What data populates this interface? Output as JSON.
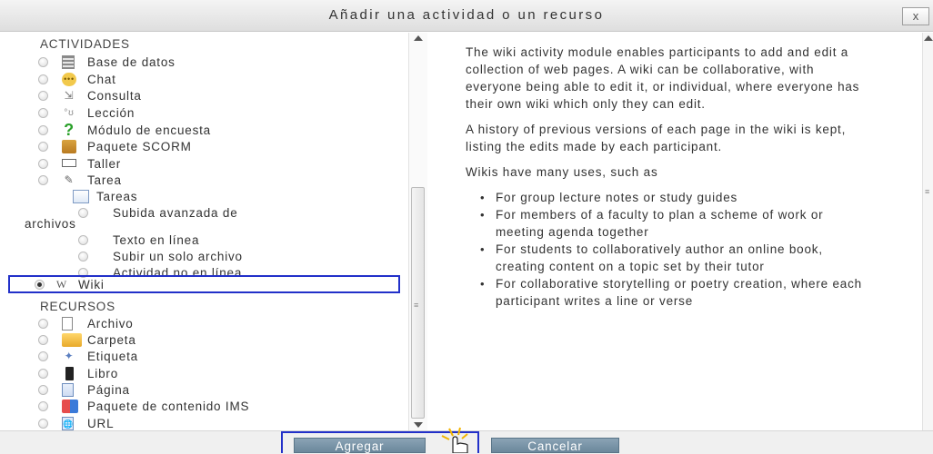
{
  "dialog": {
    "title": "Añadir una actividad o un recurso",
    "close_label": "x"
  },
  "left": {
    "activities_heading": "ACTIVIDADES",
    "activities": [
      {
        "label": "Base de datos",
        "icon": "database-icon"
      },
      {
        "label": "Chat",
        "icon": "chat-icon"
      },
      {
        "label": "Consulta",
        "icon": "choice-icon"
      },
      {
        "label": "Lección",
        "icon": "lesson-icon"
      },
      {
        "label": "Módulo de encuesta",
        "icon": "survey-icon"
      },
      {
        "label": "Paquete SCORM",
        "icon": "scorm-icon"
      },
      {
        "label": "Taller",
        "icon": "workshop-icon"
      },
      {
        "label": "Tarea",
        "icon": "assignment-icon"
      }
    ],
    "tareas_group_label": "Tareas",
    "tareas_sub": [
      {
        "label": "Subida avanzada de"
      },
      {
        "label": "archivos"
      },
      {
        "label": "Texto en línea"
      },
      {
        "label": "Subir un solo archivo"
      },
      {
        "label": "Actividad no en línea"
      }
    ],
    "wiki": {
      "label": "Wiki",
      "icon": "wiki-icon",
      "selected": true
    },
    "resources_heading": "RECURSOS",
    "resources": [
      {
        "label": "Archivo",
        "icon": "file-icon"
      },
      {
        "label": "Carpeta",
        "icon": "folder-icon"
      },
      {
        "label": "Etiqueta",
        "icon": "label-icon"
      },
      {
        "label": "Libro",
        "icon": "book-icon"
      },
      {
        "label": "Página",
        "icon": "page-icon"
      },
      {
        "label": "Paquete de contenido IMS",
        "icon": "ims-icon"
      },
      {
        "label": "URL",
        "icon": "url-icon"
      }
    ]
  },
  "description": {
    "p1": "The wiki activity module enables participants to add and edit a collection of web pages. A wiki can be collaborative, with everyone being able to edit it, or individual, where everyone has their own wiki which only they can edit.",
    "p2": "A history of previous versions of each page in the wiki is kept, listing the edits made by each participant.",
    "p3": "Wikis have many uses, such as",
    "bullets": [
      "For group lecture notes or study guides",
      "For members of a faculty to plan a scheme of work or meeting agenda together",
      "For students to collaboratively author an online book, creating content on a topic set by their tutor",
      "For collaborative storytelling or poetry creation, where each participant writes a line or verse"
    ]
  },
  "buttons": {
    "add": "Agregar",
    "cancel": "Cancelar"
  },
  "colors": {
    "highlight": "#2230c9",
    "button": "#7b96aa"
  }
}
